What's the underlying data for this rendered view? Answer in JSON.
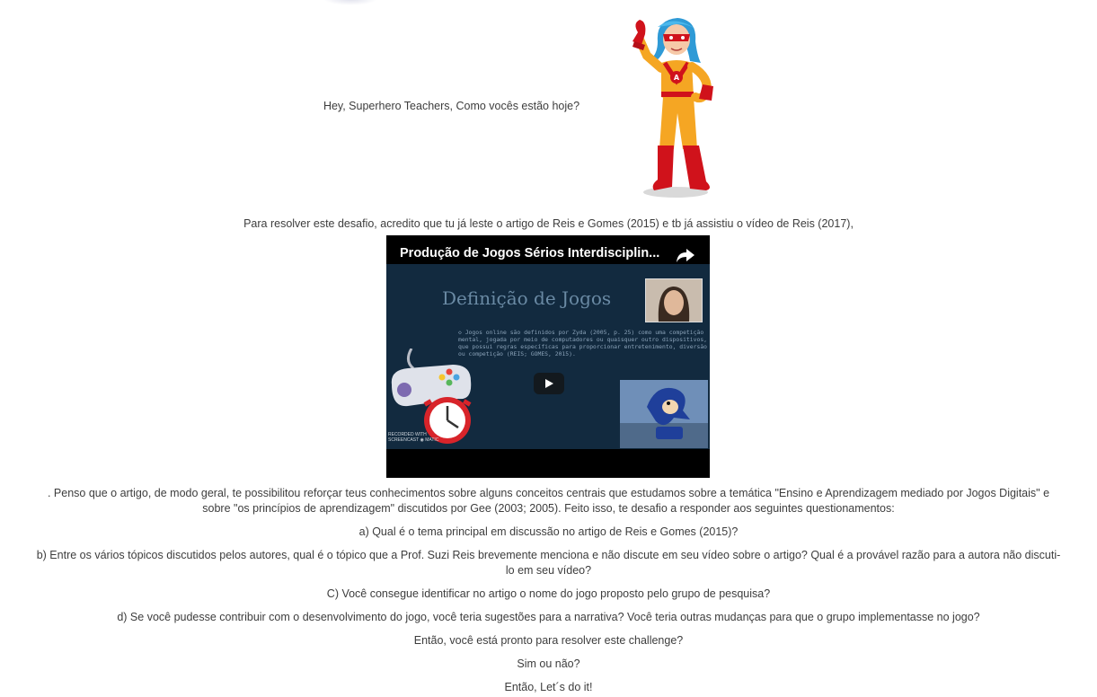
{
  "greeting": "Hey, Superhero Teachers, Como vocês estão hoje?",
  "intro": "Para resolver este desafio, acredito que tu já leste o artigo de Reis e Gomes (2015) e tb já assistiu o vídeo de Reis (2017),",
  "video": {
    "title": "Produção de Jogos Sérios Interdisciplin...",
    "slide_title": "Definição de Jogos",
    "slide_text": "◇ Jogos online são definidos por Zyda (2005, p. 25) como uma competição\nmental, jogada por meio de computadores ou quaisquer outro dispositivos,\nque possui regras específicas para proporcionar entretenimento, diversão\nou competição (REIS; GOMES, 2015).",
    "watermark_line1": "RECORDED WITH",
    "watermark_line2": "SCREENCAST ◉ MATIC",
    "sonic_caption": "Sonic the Hedgehog\nSonic Heroes"
  },
  "body_line1": ". Penso que o artigo, de modo geral, te possibilitou reforçar teus conhecimentos sobre alguns conceitos centrais que estudamos sobre a temática \"Ensino e Aprendizagem mediado por Jogos Digitais\" e",
  "body_line2": "sobre \"os princípios de aprendizagem\" discutidos por Gee (2003; 2005). Feito isso, te desafio a responder aos seguintes questionamentos:",
  "question_a": "a) Qual é o tema principal em discussão no artigo de Reis e Gomes (2015)?",
  "question_b_line1": "b) Entre os vários tópicos discutidos pelos autores, qual é o tópico que a Prof. Suzi Reis brevemente menciona e não discute em seu vídeo sobre o artigo? Qual é a provável razão para a autora não discuti-",
  "question_b_line2": "lo em seu vídeo?",
  "question_c": "C) Você consegue identificar no artigo o nome do jogo proposto pelo grupo de pesquisa?",
  "question_d": "d) Se você pudesse contribuir com o desenvolvimento do jogo, você teria sugestões para a narrativa? Você teria outras mudanças para  que o grupo implementasse no jogo?",
  "ready": "Então, você está pronto para resolver este challenge?",
  "yes_no": "Sim ou não?",
  "lets_do": "Então, Let´s do it!",
  "colors": {
    "video_bg": "#122a3f",
    "text": "#3d3d3d",
    "hero_suit": "#f5a623",
    "hero_red": "#d0121b",
    "hero_hair": "#39a8e0"
  }
}
